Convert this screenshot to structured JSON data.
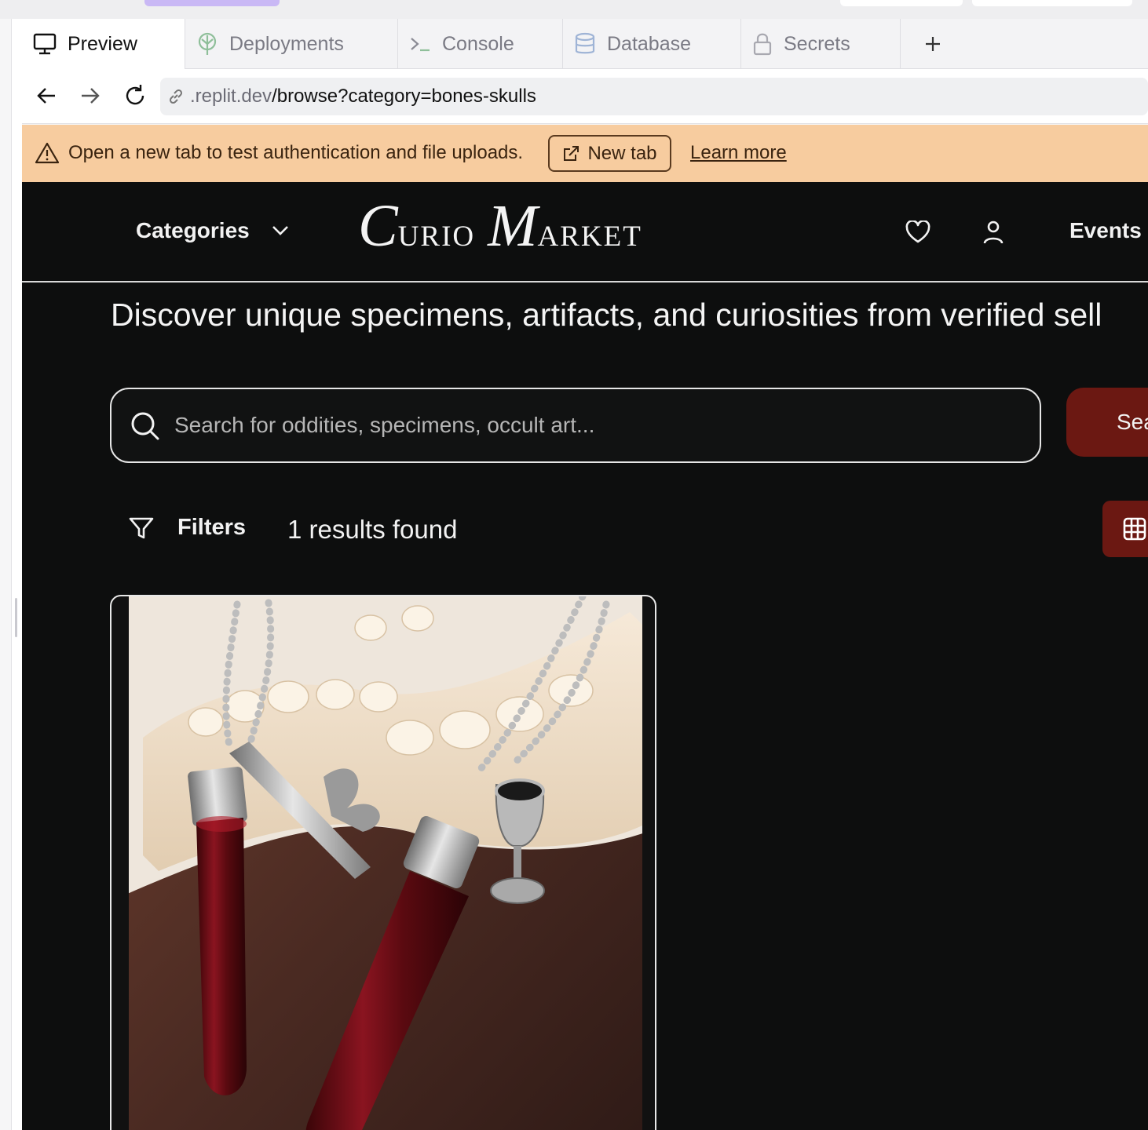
{
  "ide": {
    "tabs": [
      {
        "label": "Preview",
        "icon": "monitor-icon",
        "active": true
      },
      {
        "label": "Deployments",
        "icon": "deployments-icon",
        "active": false
      },
      {
        "label": "Console",
        "icon": "terminal-icon",
        "active": false
      },
      {
        "label": "Database",
        "icon": "database-icon",
        "active": false
      },
      {
        "label": "Secrets",
        "icon": "lock-icon",
        "active": false
      }
    ],
    "add_tab_icon": "plus-icon"
  },
  "address_bar": {
    "host": ".replit.dev",
    "path": "/browse?category=bones-skulls"
  },
  "banner": {
    "text": "Open a new tab to test authentication and file uploads.",
    "button_label": "New tab",
    "link_label": "Learn more",
    "background": "#f7cc9f"
  },
  "site": {
    "nav": {
      "categories_label": "Categories",
      "events_label": "Events"
    },
    "logo": {
      "word1_cap": "C",
      "word1_rest": "URIO",
      "word2_cap": "M",
      "word2_rest": "ARKET"
    },
    "tagline": "Discover unique specimens, artifacts, and curiosities from verified sell",
    "search": {
      "placeholder": "Search for oddities, specimens, occult art...",
      "button_label": "Sea"
    },
    "filters_label": "Filters",
    "results_text": "1 results found",
    "accent": "#6b1812",
    "background": "#0d0e0e"
  }
}
